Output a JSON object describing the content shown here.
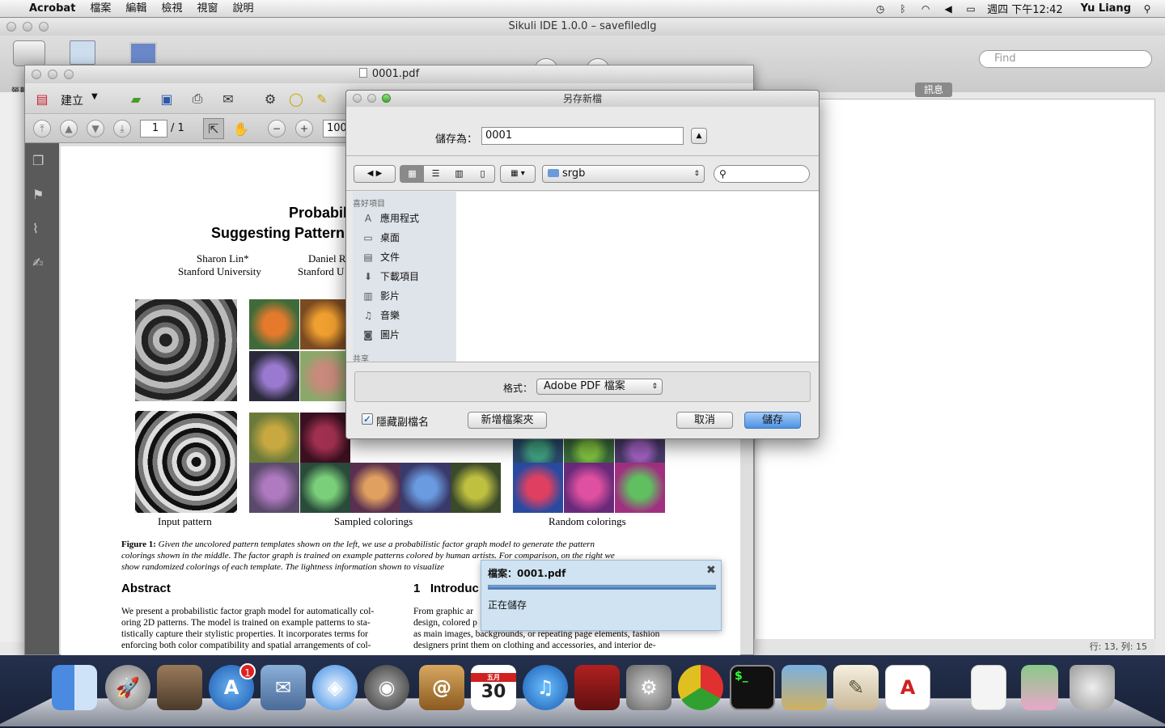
{
  "menubar": {
    "app": "Acrobat",
    "items": [
      "檔案",
      "編輯",
      "檢視",
      "視窗",
      "說明"
    ],
    "clock": "週四 下午12:42",
    "user": "Yu Liang"
  },
  "sikuli": {
    "title": "Sikuli IDE 1.0.0 – savefiledlg",
    "find_placeholder": "Find",
    "msg_tab": "訊息",
    "status": "行: 13, 列: 15",
    "left_label": "螢幕"
  },
  "acrobat": {
    "title": "0001.pdf",
    "create_label": "建立",
    "page_current": "1",
    "page_total": "/ 1",
    "zoom": "100",
    "page": {
      "title1": "Probabil",
      "title2": "Suggesting Pattern",
      "author1_name": "Sharon Lin*",
      "author1_aff": "Stanford University",
      "author2_name": "Daniel R",
      "author2_aff": "Stanford U",
      "cap_input": "Input pattern",
      "cap_sampled": "Sampled colorings",
      "cap_random": "Random colorings",
      "figure_lbl": "Figure 1:",
      "figure_l1": "Given the uncolored pattern templates shown on the left, we use a probabilistic factor graph model to generate the pattern",
      "figure_l2": "colorings shown in the middle. The factor graph is trained on example patterns colored by human artists. For comparison, on the right we",
      "figure_l3": "show randomized colorings of each template. The lightness information shown to visualize",
      "abstract_h": "Abstract",
      "intro_h": "1   Introduc",
      "abs_l1": "We present a probabilistic factor graph model for automatically col-",
      "abs_l2": "oring 2D patterns. The model is trained on example patterns to sta-",
      "abs_l3": "tistically capture their stylistic properties. It incorporates terms for",
      "abs_l4": "enforcing both color compatibility and spatial arrangements of col-",
      "intro_l1": "From graphic ar",
      "intro_l2": "design, colored p",
      "intro_l3": "as main images, backgrounds, or repeating page elements, fashion",
      "intro_l4": "designers print them on clothing and accessories, and interior de-"
    }
  },
  "dialog": {
    "title": "另存新檔",
    "save_as_label": "儲存為：",
    "filename": "0001",
    "location": "srgb",
    "sidebar_header": "喜好項目",
    "sidebar_items": [
      "應用程式",
      "桌面",
      "文件",
      "下載項目",
      "影片",
      "音樂",
      "圖片"
    ],
    "shared_header": "共享",
    "format_label": "格式：",
    "format_value": "Adobe PDF 檔案",
    "hide_ext_label": "隱藏副檔名",
    "new_folder": "新增檔案夾",
    "cancel": "取消",
    "save": "儲存"
  },
  "notification": {
    "file": "檔案：0001.pdf",
    "status": "正在儲存",
    "progress": 1.0
  },
  "dock": {
    "calendar_day": "30",
    "calendar_month": "五月",
    "appstore_badge": "1"
  }
}
